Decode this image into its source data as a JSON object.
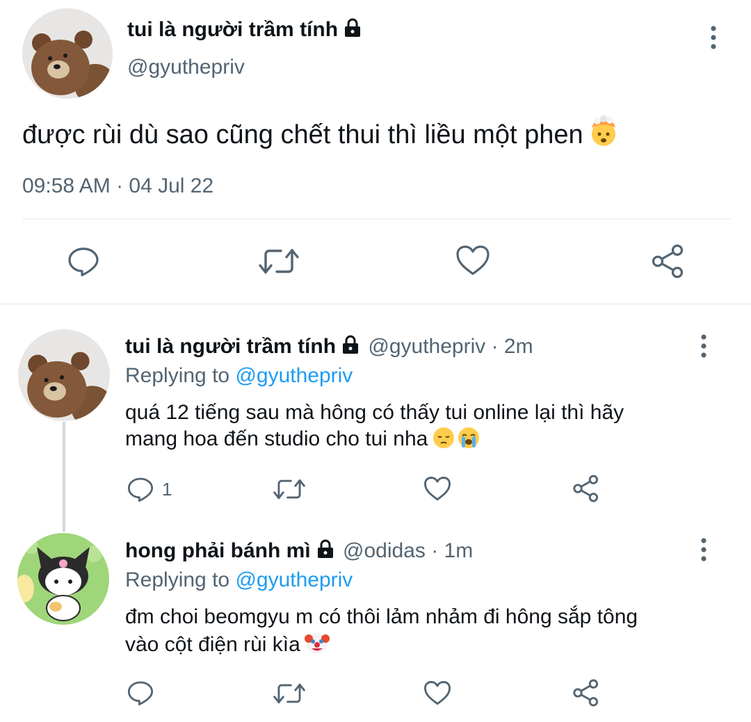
{
  "main_tweet": {
    "display_name": "tui là người trầm tính",
    "handle": "@gyuthepriv",
    "text": "được rùi dù sao cũng chết thui thì liều một phen",
    "timestamp": "09:58 AM · 04 Jul 22",
    "emoji": "exploding-head-emoji"
  },
  "replies": [
    {
      "display_name": "tui là người trầm tính",
      "handle": "@gyuthepriv",
      "time": "· 2m",
      "replying_prefix": "Replying to",
      "replying_to": "@gyuthepriv",
      "text_line1": "quá 12 tiếng sau mà hông có thấy tui online lại thì hãy",
      "text_line2": "mang hoa đến studio cho tui nha",
      "reply_count": "1"
    },
    {
      "display_name": "hong phải bánh mì",
      "handle": "@odidas",
      "time": "· 1m",
      "replying_prefix": "Replying to",
      "replying_to": "@gyuthepriv",
      "text_line1": "đm choi beomgyu m có thôi lảm nhảm đi hông sắp tông",
      "text_line2": "vào cột điện rùi kìa"
    }
  ],
  "colors": {
    "text": "#0f1419",
    "secondary": "#536471",
    "link": "#1d9bf0",
    "divider": "#eff3f4"
  }
}
